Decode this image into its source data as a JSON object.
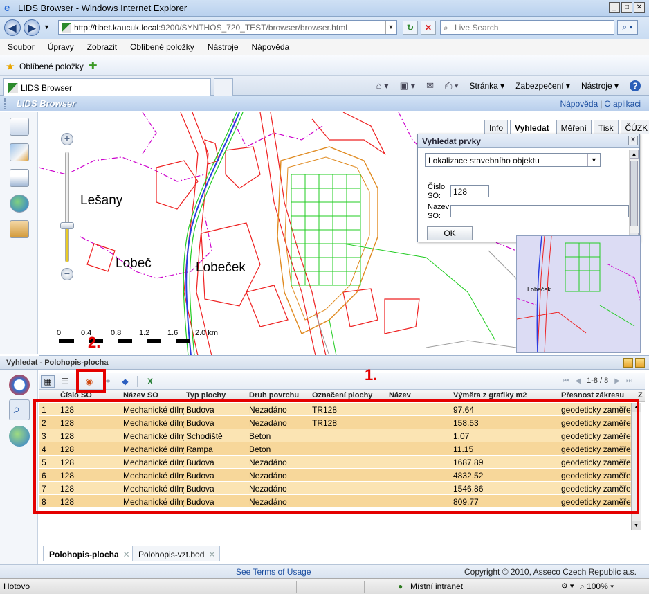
{
  "window": {
    "title": "LIDS Browser - Windows Internet Explorer",
    "buttons": [
      "_",
      "□",
      "✕"
    ]
  },
  "address": {
    "url_domain": "http://tibet.kaucuk.local",
    "url_rest": ":9200/SYNTHOS_720_TEST/browser/browser.html",
    "search_placeholder": "Live Search"
  },
  "menu": [
    "Soubor",
    "Úpravy",
    "Zobrazit",
    "Oblíbené položky",
    "Nástroje",
    "Nápověda"
  ],
  "favorites": {
    "label": "Oblíbené položky"
  },
  "ie_tab": {
    "label": "LIDS Browser"
  },
  "commands": [
    "Stránka ▾",
    "Zabezpečení ▾",
    "Nástroje ▾",
    "?"
  ],
  "app": {
    "title": "LIDS Browser",
    "links": [
      "Nápověda",
      "O aplikaci"
    ]
  },
  "map": {
    "places": [
      "Lešany",
      "Lobeč",
      "Lobeček"
    ],
    "scale_labels": [
      "0",
      "0.4",
      "0.8",
      "1.2",
      "1.6",
      "2.0 km"
    ],
    "zoom_level": 0.33,
    "minimap_place": "Lobeček",
    "tabs": [
      "Info",
      "Vyhledat",
      "Měření",
      "Tisk",
      "ČÚZK"
    ],
    "active_tab": "Vyhledat"
  },
  "search_panel": {
    "title": "Vyhledat prvky",
    "type_value": "Lokalizace stavebního objektu",
    "field1_label": "Číslo SO:",
    "field1_value": "128",
    "field2_label": "Název SO:",
    "field2_value": "",
    "ok_label": "OK"
  },
  "results": {
    "title": "Vyhledat - Polohopis-plocha",
    "pager": "1-8 / 8",
    "columns": [
      "Číslo SO",
      "Název SO",
      "Typ plochy",
      "Druh povrchu",
      "Označení plochy",
      "Název",
      "Výměra z grafiky m2",
      "Přesnost zákresu",
      "Z"
    ],
    "rows": [
      [
        "1",
        "128",
        "Mechanické dílny",
        "Budova",
        "Nezadáno",
        "TR128",
        "",
        "97.64",
        "geodeticky zaměřeno"
      ],
      [
        "2",
        "128",
        "Mechanické dílny",
        "Budova",
        "Nezadáno",
        "TR128",
        "",
        "158.53",
        "geodeticky zaměřeno"
      ],
      [
        "3",
        "128",
        "Mechanické dílny",
        "Schodiště",
        "Beton",
        "",
        "",
        "1.07",
        "geodeticky zaměřeno"
      ],
      [
        "4",
        "128",
        "Mechanické dílny",
        "Rampa",
        "Beton",
        "",
        "",
        "11.15",
        "geodeticky zaměřeno"
      ],
      [
        "5",
        "128",
        "Mechanické dílny",
        "Budova",
        "Nezadáno",
        "",
        "",
        "1687.89",
        "geodeticky zaměřeno"
      ],
      [
        "6",
        "128",
        "Mechanické dílny",
        "Budova",
        "Nezadáno",
        "",
        "",
        "4832.52",
        "geodeticky zaměřeno"
      ],
      [
        "7",
        "128",
        "Mechanické dílny",
        "Budova",
        "Nezadáno",
        "",
        "",
        "1546.86",
        "geodeticky zaměřeno"
      ],
      [
        "8",
        "128",
        "Mechanické dílny",
        "Budova",
        "Nezadáno",
        "",
        "",
        "809.77",
        "geodeticky zaměřeno"
      ]
    ],
    "tabs": [
      "Polohopis-plocha",
      "Polohopis-vzt.bod"
    ],
    "active_tab": "Polohopis-plocha"
  },
  "annotations": [
    "1.",
    "2."
  ],
  "footer": {
    "terms": "See Terms of Usage",
    "copyright": "Copyright © 2010, Asseco Czech Republic a.s."
  },
  "status": {
    "text": "Hotovo",
    "zone": "Místní intranet",
    "zoom": "100%"
  },
  "colors": {
    "row": "#fbe4b3",
    "row_alt": "#f7d79a",
    "highlight": "#e40000",
    "road": "#ee2020",
    "boundary": "#cc00cc",
    "green": "#22cc22"
  }
}
